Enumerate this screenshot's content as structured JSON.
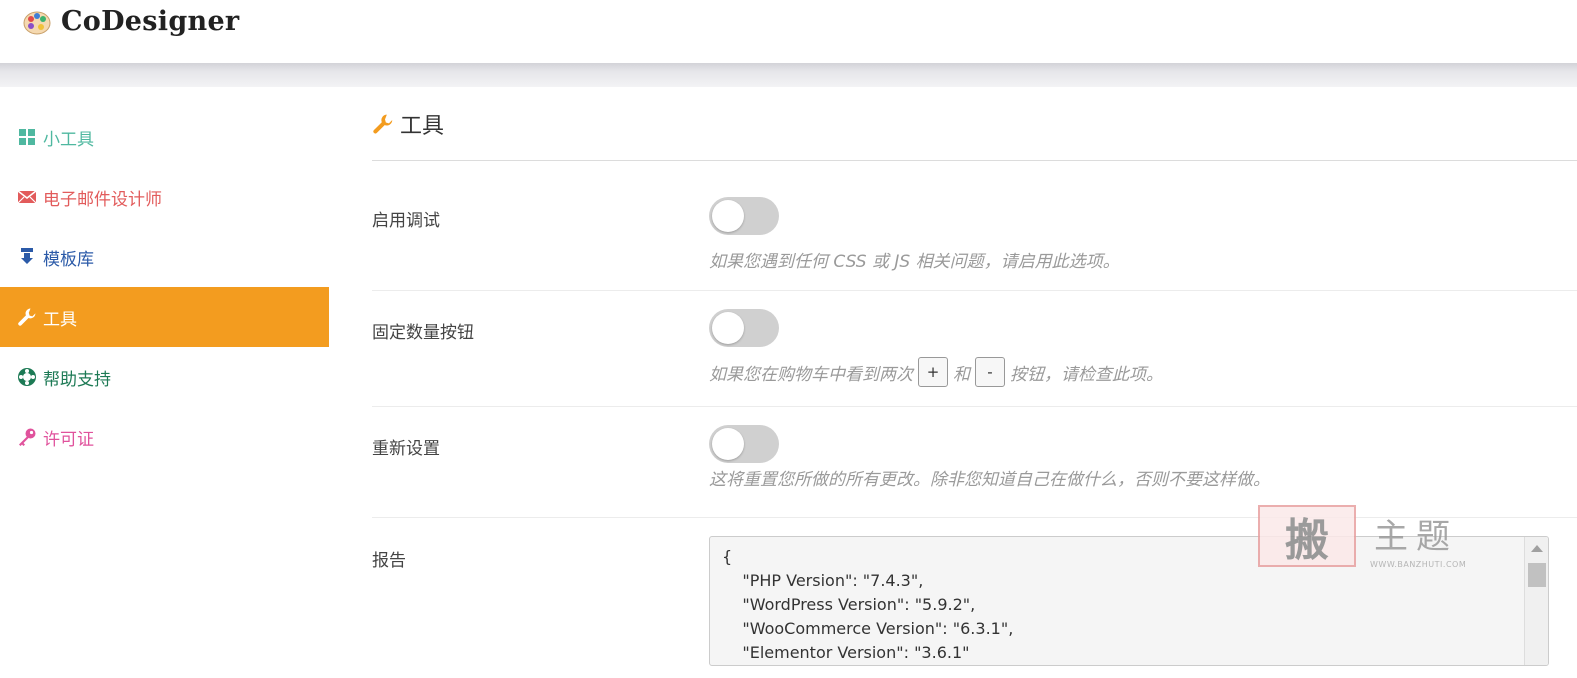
{
  "app": {
    "title": "CoDesigner"
  },
  "sidebar": {
    "items": [
      {
        "label": "小工具",
        "icon": "widgets-grid-icon",
        "color": "#4fb8a0"
      },
      {
        "label": "电子邮件设计师",
        "icon": "envelope-icon",
        "color": "#e25b5b"
      },
      {
        "label": "模板库",
        "icon": "download-icon",
        "color": "#2b5aa8"
      },
      {
        "label": "工具",
        "icon": "wrench-icon",
        "color": "#ffffff",
        "active": true
      },
      {
        "label": "帮助支持",
        "icon": "lifebuoy-icon",
        "color": "#1d7a55"
      },
      {
        "label": "许可证",
        "icon": "key-icon",
        "color": "#e0529c"
      }
    ],
    "active_bg": "#f39c1f"
  },
  "main": {
    "title": "工具",
    "settings": [
      {
        "label": "启用调试",
        "description": "如果您遇到任何 CSS 或 JS 相关问题，请启用此选项。",
        "enabled": false
      },
      {
        "label": "固定数量按钮",
        "description_before": "如果您在购物车中看到两次",
        "plus": "+",
        "and": "和",
        "minus": "-",
        "description_after": "按钮，请检查此项。",
        "enabled": false
      },
      {
        "label": "重新设置",
        "description": "这将重置您所做的所有更改。除非您知道自己在做什么，否则不要这样做。",
        "enabled": false
      }
    ],
    "report": {
      "label": "报告",
      "lines": [
        "{",
        "    \"PHP Version\": \"7.4.3\",",
        "    \"WordPress Version\": \"5.9.2\",",
        "    \"WooCommerce Version\": \"6.3.1\",",
        "    \"Elementor Version\": \"3.6.1\""
      ]
    }
  },
  "watermark": {
    "seal": "搬",
    "text": "主题",
    "url": "WWW.BANZHUTI.COM"
  }
}
